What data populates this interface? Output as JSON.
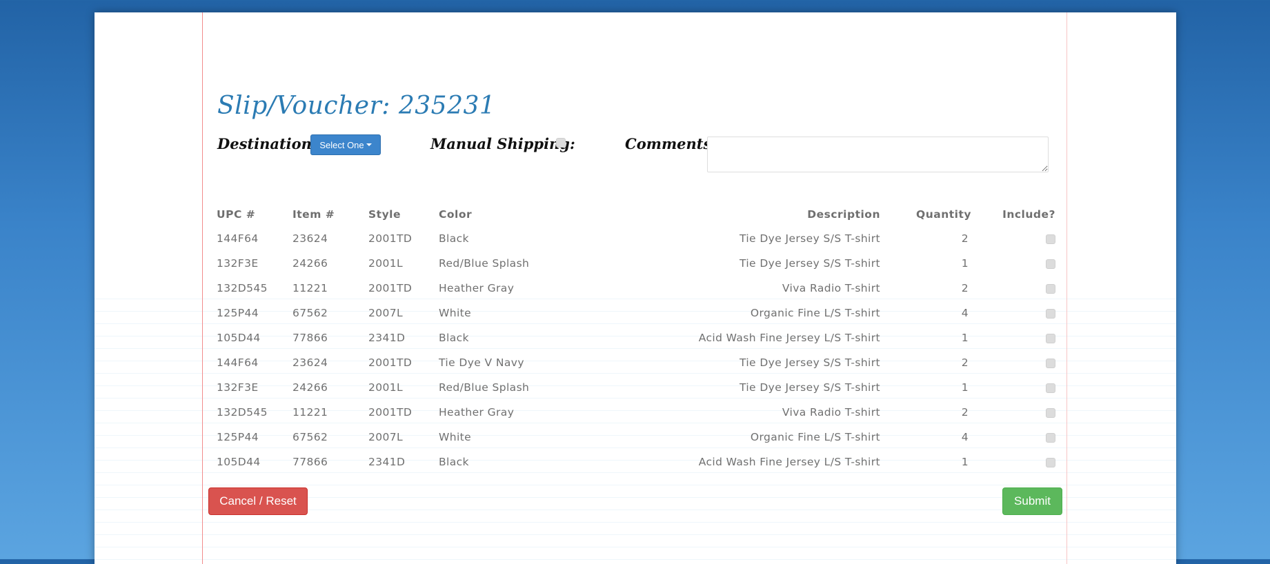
{
  "header": {
    "title": "Slip/Voucher: 235231"
  },
  "form": {
    "destination_label": "Destination:",
    "destination_select": "Select One",
    "manual_shipping_label": "Manual Shipping:",
    "manual_shipping_checked": false,
    "comments_label": "Comments:",
    "comments_value": ""
  },
  "table": {
    "columns": [
      "UPC #",
      "Item #",
      "Style",
      "Color",
      "Description",
      "Quantity",
      "Include?"
    ],
    "rows": [
      {
        "upc": "144F64",
        "item": "23624",
        "style": "2001TD",
        "color": "Black",
        "description": "Tie Dye Jersey S/S T-shirt",
        "quantity": "2"
      },
      {
        "upc": "132F3E",
        "item": "24266",
        "style": "2001L",
        "color": "Red/Blue Splash",
        "description": "Tie Dye Jersey S/S T-shirt",
        "quantity": "1"
      },
      {
        "upc": "132D545",
        "item": "11221",
        "style": "2001TD",
        "color": "Heather Gray",
        "description": "Viva Radio T-shirt",
        "quantity": "2"
      },
      {
        "upc": "125P44",
        "item": "67562",
        "style": "2007L",
        "color": "White",
        "description": "Organic Fine L/S T-shirt",
        "quantity": "4"
      },
      {
        "upc": "105D44",
        "item": "77866",
        "style": "2341D",
        "color": "Black",
        "description": "Acid Wash Fine Jersey L/S T-shirt",
        "quantity": "1"
      },
      {
        "upc": "144F64",
        "item": "23624",
        "style": "2001TD",
        "color": "Tie Dye V Navy",
        "description": "Tie Dye Jersey S/S T-shirt",
        "quantity": "2"
      },
      {
        "upc": "132F3E",
        "item": "24266",
        "style": "2001L",
        "color": "Red/Blue Splash",
        "description": "Tie Dye Jersey S/S T-shirt",
        "quantity": "1"
      },
      {
        "upc": "132D545",
        "item": "11221",
        "style": "2001TD",
        "color": "Heather Gray",
        "description": "Viva Radio T-shirt",
        "quantity": "2"
      },
      {
        "upc": "125P44",
        "item": "67562",
        "style": "2007L",
        "color": "White",
        "description": "Organic Fine L/S T-shirt",
        "quantity": "4"
      },
      {
        "upc": "105D44",
        "item": "77866",
        "style": "2341D",
        "color": "Black",
        "description": "Acid Wash Fine Jersey L/S T-shirt",
        "quantity": "1"
      }
    ]
  },
  "actions": {
    "cancel_label": "Cancel / Reset",
    "submit_label": "Submit"
  },
  "colors": {
    "title": "#2b7bb3",
    "primary": "#3c85cc",
    "danger": "#d9534f",
    "success": "#5cb85c"
  }
}
